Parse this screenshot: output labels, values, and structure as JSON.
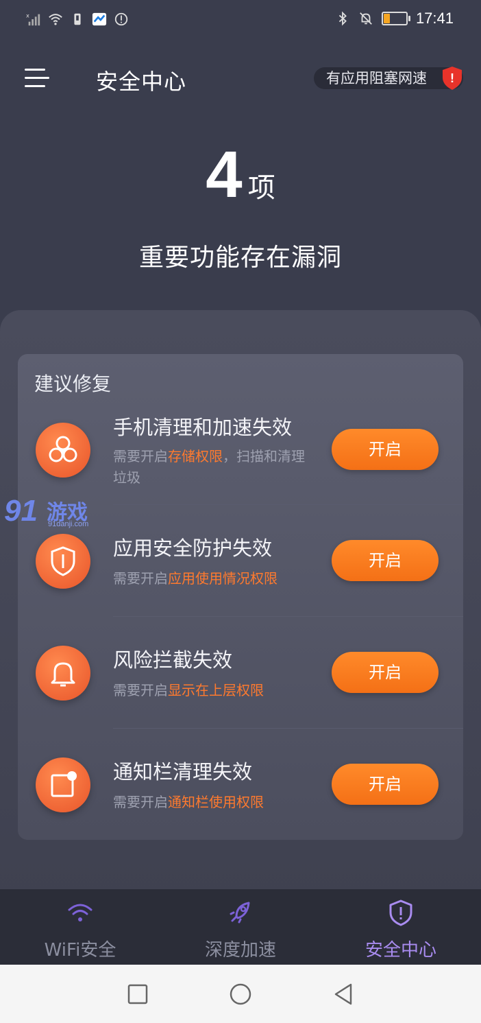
{
  "status_bar": {
    "time": "17:41",
    "left_icons": [
      "signal-icon",
      "wifi-icon",
      "sim-icon",
      "app-notification-icon",
      "alert-circle-icon"
    ],
    "right_icons": [
      "bluetooth-icon",
      "mute-bell-icon",
      "battery-icon"
    ]
  },
  "header": {
    "title": "安全中心",
    "alert_text": "有应用阻塞网速",
    "alert_badge": "!"
  },
  "hero": {
    "count": "4",
    "unit": "项",
    "subtitle": "重要功能存在漏洞"
  },
  "card": {
    "title": "建议修复",
    "items": [
      {
        "icon": "fan-icon",
        "name": "手机清理和加速失效",
        "desc_prefix": "需要开启",
        "desc_highlight": "存储权限",
        "desc_suffix": "，扫描和清理垃圾",
        "button": "开启"
      },
      {
        "icon": "shield-icon",
        "name": "应用安全防护失效",
        "desc_prefix": "需要开启",
        "desc_highlight": "应用使用情况权限",
        "desc_suffix": "",
        "button": "开启"
      },
      {
        "icon": "bell-icon",
        "name": "风险拦截失效",
        "desc_prefix": "需要开启",
        "desc_highlight": "显示在上层权限",
        "desc_suffix": "",
        "button": "开启"
      },
      {
        "icon": "notification-badge-icon",
        "name": "通知栏清理失效",
        "desc_prefix": "需要开启",
        "desc_highlight": "通知栏使用权限",
        "desc_suffix": "",
        "button": "开启"
      }
    ]
  },
  "watermark": {
    "number": "91",
    "text": "游戏",
    "domain": "91danji.com"
  },
  "tabs": [
    {
      "label": "WiFi安全",
      "icon": "wifi-icon",
      "active": false
    },
    {
      "label": "深度加速",
      "icon": "rocket-icon",
      "active": false
    },
    {
      "label": "安全中心",
      "icon": "shield-alert-icon",
      "active": true
    }
  ],
  "colors": {
    "background": "#3a3d4d",
    "accent_orange": "#f47016",
    "tab_inactive": "#8c8fa0",
    "tab_active": "#a98cf0",
    "icon_inactive": "#7d62d8",
    "alert_red": "#e8332a"
  },
  "nav_bar": {
    "buttons": [
      "recents-square-icon",
      "home-circle-icon",
      "back-triangle-icon"
    ]
  }
}
